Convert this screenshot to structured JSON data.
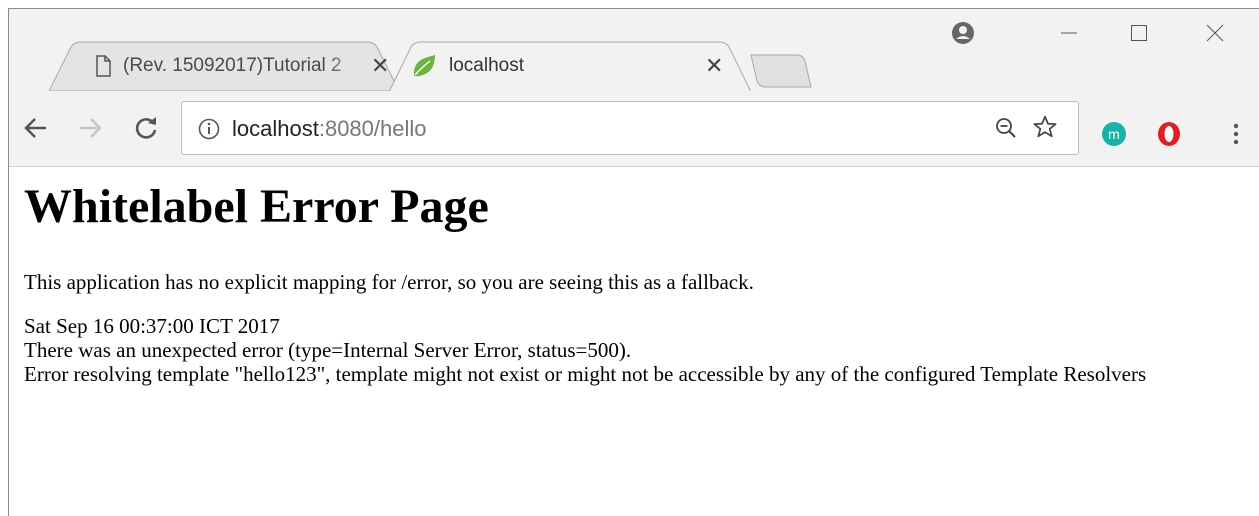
{
  "browser": {
    "tabs": [
      {
        "title": "(Rev. 15092017)Tutorial 2",
        "close": "✕",
        "active": false,
        "favicon": "page-icon"
      },
      {
        "title": "localhost",
        "close": "✕",
        "active": true,
        "favicon": "spring-leaf-icon"
      }
    ],
    "address": {
      "host": "localhost",
      "rest": ":8080/hello"
    },
    "icons": {
      "back": "back-arrow-icon",
      "forward": "forward-arrow-icon",
      "reload": "reload-icon",
      "info": "info-icon",
      "zoom": "zoom-icon",
      "bookmark": "star-icon",
      "ext1": "m-extension-icon",
      "ext2": "opera-icon",
      "menu": "kebab-menu-icon",
      "account": "account-icon",
      "minimize": "minimize-icon",
      "maximize": "maximize-icon",
      "close": "close-icon"
    },
    "colors": {
      "chrome": "#f2f2f2",
      "ext_m": "#17b3a8",
      "opera": "#e02020",
      "spring_leaf": "#6db33f"
    }
  },
  "page": {
    "heading": "Whitelabel Error Page",
    "message": "This application has no explicit mapping for /error, so you are seeing this as a fallback.",
    "timestamp": "Sat Sep 16 00:37:00 ICT 2017",
    "error_line": "There was an unexpected error (type=Internal Server Error, status=500).",
    "detail": "Error resolving template \"hello123\", template might not exist or might not be accessible by any of the configured Template Resolvers"
  }
}
